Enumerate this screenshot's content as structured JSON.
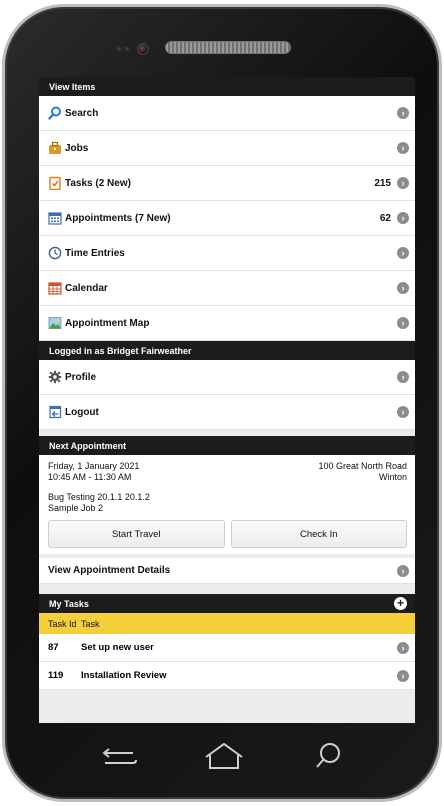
{
  "view_items": {
    "header": "View Items",
    "items": [
      {
        "label": "Search",
        "icon": "search-icon",
        "count": ""
      },
      {
        "label": "Jobs",
        "icon": "briefcase-icon",
        "count": ""
      },
      {
        "label": "Tasks (2 New)",
        "icon": "clipboard-check-icon",
        "count": "215"
      },
      {
        "label": "Appointments (7 New)",
        "icon": "calendar-grid-icon",
        "count": "62"
      },
      {
        "label": "Time Entries",
        "icon": "clock-icon",
        "count": ""
      },
      {
        "label": "Calendar",
        "icon": "calendar-icon",
        "count": ""
      },
      {
        "label": "Appointment Map",
        "icon": "map-icon",
        "count": ""
      }
    ]
  },
  "logged_in": {
    "header": "Logged in as Bridget Fairweather",
    "items": [
      {
        "label": "Profile",
        "icon": "gear-icon"
      },
      {
        "label": "Logout",
        "icon": "logout-icon"
      }
    ]
  },
  "next_appointment": {
    "header": "Next Appointment",
    "date": "Friday, 1 January 2021",
    "time": "10:45 AM - 11:30 AM",
    "address_line1": "100 Great North Road",
    "address_line2": "Winton",
    "description": "Bug Testing 20.1.1 20.1.2",
    "job": "Sample Job 2",
    "start_travel_label": "Start Travel",
    "check_in_label": "Check In",
    "view_details_label": "View Appointment Details"
  },
  "my_tasks": {
    "header": "My Tasks",
    "col_id": "Task Id",
    "col_task": "Task",
    "rows": [
      {
        "id": "87",
        "task": "Set up new user"
      },
      {
        "id": "119",
        "task": "Installation Review"
      }
    ]
  },
  "colors": {
    "header_bg": "#1c1c1c",
    "table_head_bg": "#f5cf3b",
    "chevron": "#8c8c8c"
  }
}
